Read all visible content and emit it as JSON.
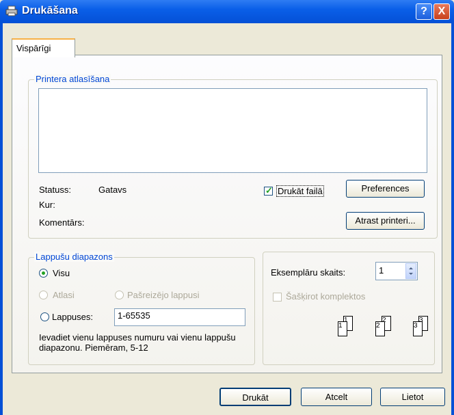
{
  "window": {
    "title": "Drukāšana"
  },
  "title_buttons": {
    "help": "?",
    "close": "X"
  },
  "tabs": [
    {
      "label": "Vispārīgi"
    }
  ],
  "printer_group": {
    "title": "Printera atlasīšana",
    "status_label": "Statuss:",
    "status_value": "Gatavs",
    "where_label": "Kur:",
    "comment_label": "Komentārs:",
    "print_to_file": {
      "label": "Drukāt failā",
      "checked": true
    },
    "preferences_button": "Preferences",
    "find_printer_button": "Atrast printeri..."
  },
  "page_range": {
    "title": "Lappušu diapazons",
    "all": "Visu",
    "selection": "Atlasi",
    "current_page": "Pašreizējo lappusi",
    "pages": "Lappuses:",
    "pages_value": "1-65535",
    "hint": "Ievadiet vienu lappuses numuru vai vienu lappušu diapazonu. Piemēram, 5-12"
  },
  "copies": {
    "count_label": "Eksemplāru skaits:",
    "count_value": "1",
    "collate_label": "Šašķirot komplektos",
    "collate_icons": [
      "1",
      "1",
      "2",
      "2",
      "3",
      "3"
    ]
  },
  "buttons": {
    "print": "Drukāt",
    "cancel": "Atcelt",
    "apply": "Lietot"
  }
}
